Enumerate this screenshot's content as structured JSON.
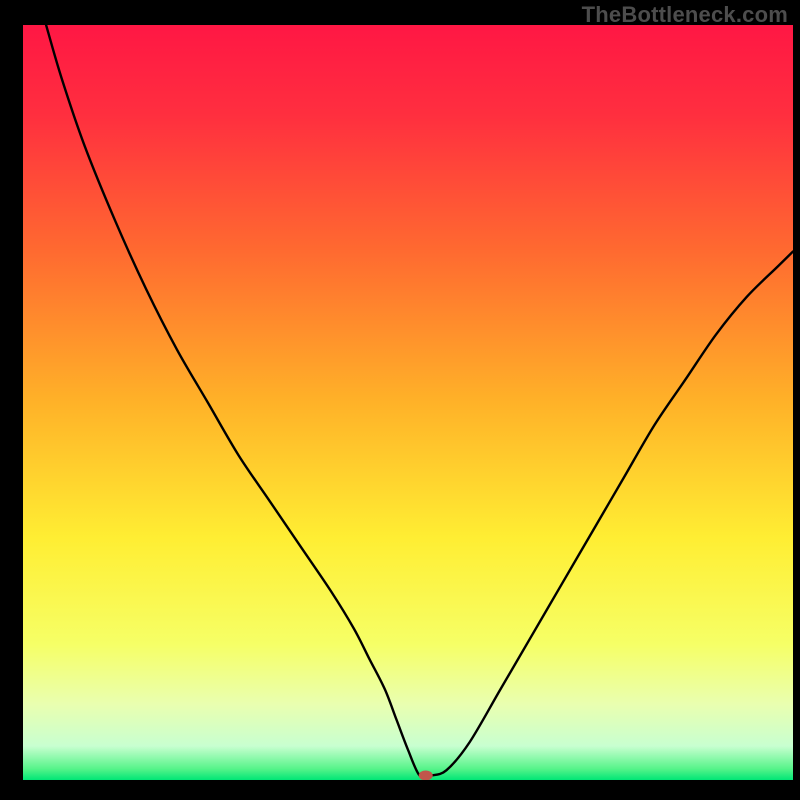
{
  "watermark": "TheBottleneck.com",
  "chart_data": {
    "type": "line",
    "title": "",
    "xlabel": "",
    "ylabel": "",
    "xlim": [
      0,
      100
    ],
    "ylim": [
      0,
      100
    ],
    "grid": false,
    "legend": false,
    "gradient_stops": [
      {
        "offset": 0.0,
        "color": "#ff1744"
      },
      {
        "offset": 0.12,
        "color": "#ff2f3f"
      },
      {
        "offset": 0.3,
        "color": "#ff6a30"
      },
      {
        "offset": 0.5,
        "color": "#ffb228"
      },
      {
        "offset": 0.68,
        "color": "#ffee33"
      },
      {
        "offset": 0.82,
        "color": "#f6ff66"
      },
      {
        "offset": 0.9,
        "color": "#e9ffb0"
      },
      {
        "offset": 0.955,
        "color": "#c8ffd0"
      },
      {
        "offset": 0.985,
        "color": "#57f48a"
      },
      {
        "offset": 1.0,
        "color": "#00e676"
      }
    ],
    "series": [
      {
        "name": "curve",
        "x": [
          3,
          5,
          8,
          12,
          16,
          20,
          24,
          28,
          32,
          36,
          40,
          43,
          45,
          47,
          48.5,
          50,
          51.5,
          53,
          55,
          58,
          62,
          66,
          70,
          74,
          78,
          82,
          86,
          90,
          94,
          98,
          100
        ],
        "y": [
          100,
          93,
          84,
          74,
          65,
          57,
          50,
          43,
          37,
          31,
          25,
          20,
          16,
          12,
          8,
          4,
          0.6,
          0.6,
          1.3,
          5,
          12,
          19,
          26,
          33,
          40,
          47,
          53,
          59,
          64,
          68,
          70
        ]
      }
    ],
    "marker": {
      "x": 52.3,
      "y": 0.6,
      "color": "#c0564b",
      "rx": 7,
      "ry": 5
    }
  }
}
